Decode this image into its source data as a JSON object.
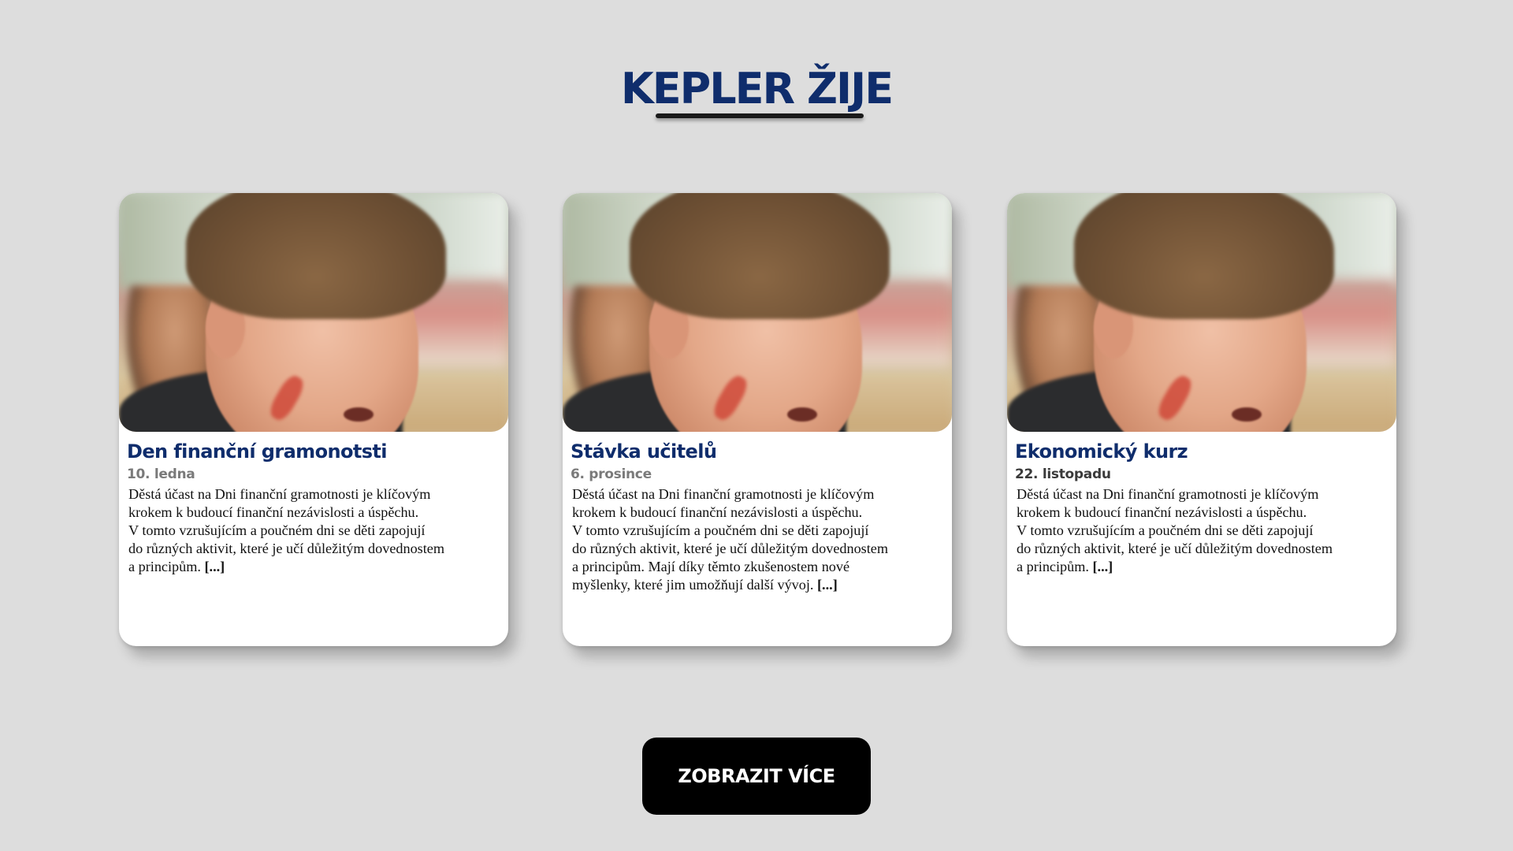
{
  "section": {
    "title": "KEPLER ŽIJE"
  },
  "cards": [
    {
      "title": "Den finanční gramonotsti",
      "date": "10. ledna",
      "text": "Děstá účast na Dni finanční gramotnosti je klíčovým\nkrokem k budoucí finanční nezávislosti a úspěchu.\nV tomto vzrušujícím a poučném dni se děti zapojují\ndo různých aktivit, které je učí důležitým dovednostem\na principům. ",
      "more": "[...]"
    },
    {
      "title": "Stávka učitelů",
      "date": "6. prosince",
      "text": "Děstá účast na Dni finanční gramotnosti je klíčovým\nkrokem k budoucí finanční nezávislosti a úspěchu.\nV tomto vzrušujícím a poučném dni se děti zapojují\ndo různých aktivit, které je učí důležitým dovednostem\na principům. Mají díky těmto zkušenostem nové\nmyšlenky, které jim umožňují další vývoj. ",
      "more": "[...]"
    },
    {
      "title": "Ekonomický kurz",
      "date": "22. listopadu",
      "text": "Děstá účast na Dni finanční gramotnosti je klíčovým\nkrokem k budoucí finanční nezávislosti a úspěchu.\nV tomto vzrušujícím a poučném dni se děti zapojují\ndo různých aktivit, které je učí důležitým dovednostem\na principům. ",
      "more": "[...]"
    }
  ],
  "more_button": {
    "label": "ZOBRAZIT VÍCE"
  }
}
